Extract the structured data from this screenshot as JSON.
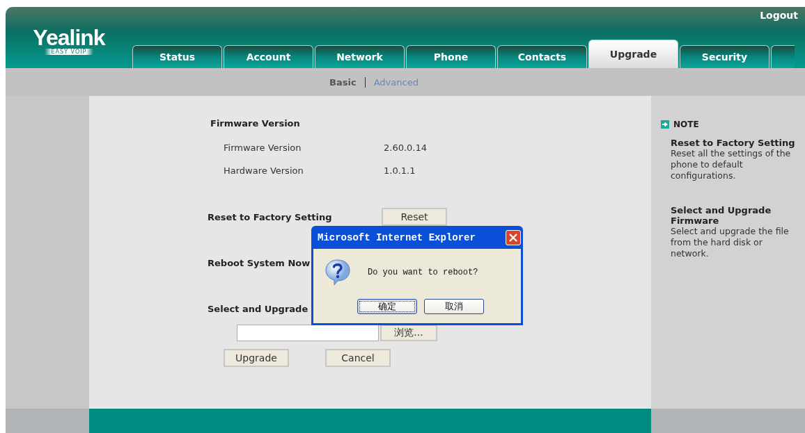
{
  "header": {
    "logo": "Yealink",
    "tagline": "EASY VOIP",
    "logout": "Logout"
  },
  "tabs": [
    {
      "label": "Status",
      "selected": false
    },
    {
      "label": "Account",
      "selected": false
    },
    {
      "label": "Network",
      "selected": false
    },
    {
      "label": "Phone",
      "selected": false
    },
    {
      "label": "Contacts",
      "selected": false
    },
    {
      "label": "Upgrade",
      "selected": true
    },
    {
      "label": "Security",
      "selected": false
    }
  ],
  "subnav": [
    {
      "label": "Basic",
      "selected": true
    },
    {
      "label": "Advanced",
      "selected": false
    }
  ],
  "section_title": "Firmware Version",
  "info_rows": [
    {
      "label": "Firmware Version",
      "value": "2.60.0.14"
    },
    {
      "label": "Hardware Version",
      "value": "1.0.1.1"
    }
  ],
  "actions": [
    {
      "kind": "button",
      "label": "Reset to Factory Setting",
      "button": "Reset"
    },
    {
      "kind": "plain",
      "label": "Reboot System Now"
    },
    {
      "kind": "file",
      "label": "Select and Upgrade",
      "browse": "浏览..."
    }
  ],
  "buttons": [
    "Upgrade",
    "Cancel"
  ],
  "note": {
    "title": "NOTE",
    "items": [
      {
        "heading": "Reset to Factory Setting",
        "text": "Reset all the settings of the phone to default configurations."
      },
      {
        "heading": "Select and Upgrade Firmware",
        "text": "Select and upgrade the file from the hard disk or network."
      }
    ]
  },
  "dialog": {
    "title": "Microsoft Internet Explorer",
    "message": "Do you want to reboot?",
    "buttons": [
      {
        "label": "确定",
        "selected": true
      },
      {
        "label": "取消",
        "selected": false
      }
    ]
  }
}
